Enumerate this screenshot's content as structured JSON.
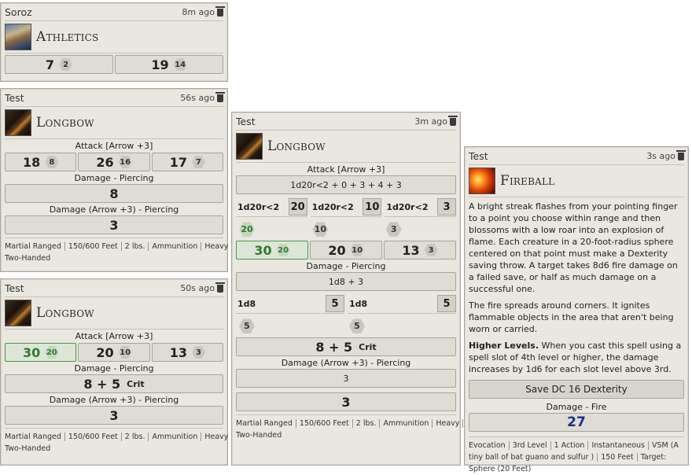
{
  "cards": {
    "athletics": {
      "user": "Soroz",
      "time": "8m ago",
      "title": "Athletics",
      "rolls": [
        {
          "total": "7",
          "die": "2"
        },
        {
          "total": "19",
          "die": "14"
        }
      ]
    },
    "longbow1": {
      "user": "Test",
      "time": "56s ago",
      "title": "Longbow",
      "attack_label": "Attack [Arrow +3]",
      "attacks": [
        {
          "total": "18",
          "die": "8"
        },
        {
          "total": "26",
          "die": "16"
        },
        {
          "total": "17",
          "die": "7"
        }
      ],
      "damage1_label": "Damage - Piercing",
      "damage1": "8",
      "damage2_label": "Damage (Arrow +3) - Piercing",
      "damage2": "3",
      "props": [
        "Martial Ranged",
        "150/600 Feet",
        "2 lbs.",
        "Ammunition",
        "Heavy",
        "Two-Handed"
      ]
    },
    "longbow2": {
      "user": "Test",
      "time": "50s ago",
      "title": "Longbow",
      "attack_label": "Attack [Arrow +3]",
      "attacks": [
        {
          "total": "30",
          "die": "20"
        },
        {
          "total": "20",
          "die": "10"
        },
        {
          "total": "13",
          "die": "3"
        }
      ],
      "damage1_label": "Damage - Piercing",
      "damage1": "8 + 5",
      "crit": "Crit",
      "damage2_label": "Damage (Arrow +3) - Piercing",
      "damage2": "3",
      "props": [
        "Martial Ranged",
        "150/600 Feet",
        "2 lbs.",
        "Ammunition",
        "Heavy",
        "Two-Handed"
      ]
    },
    "longbow3": {
      "user": "Test",
      "time": "3m ago",
      "title": "Longbow",
      "attack_label": "Attack [Arrow +3]",
      "formula": "1d20r<2 + 0 + 3 + 4 + 3",
      "dice": [
        {
          "label": "1d20r<2",
          "value": "20"
        },
        {
          "label": "1d20r<2",
          "value": "10"
        },
        {
          "label": "1d20r<2",
          "value": "3"
        }
      ],
      "attacks": [
        {
          "total": "30",
          "die": "20"
        },
        {
          "total": "20",
          "die": "10"
        },
        {
          "total": "13",
          "die": "3"
        }
      ],
      "damage1_label": "Damage - Piercing",
      "damage_formula": "1d8 + 3",
      "damage_dice": [
        {
          "label": "1d8",
          "value": "5"
        },
        {
          "label": "1d8",
          "value": "5"
        }
      ],
      "damage1": "8 + 5",
      "crit": "Crit",
      "damage2_label": "Damage (Arrow +3) - Piercing",
      "damage2_formula": "3",
      "damage2": "3",
      "props": [
        "Martial Ranged",
        "150/600 Feet",
        "2 lbs.",
        "Ammunition",
        "Heavy",
        "Two-Handed"
      ]
    },
    "fireball": {
      "user": "Test",
      "time": "3s ago",
      "title": "Fireball",
      "desc1": "A bright streak flashes from your pointing finger to a point you choose within range and then blossoms with a low roar into an explosion of flame. Each creature in a 20-foot-radius sphere centered on that point must make a Dexterity saving throw. A target takes 8d6 fire damage on a failed save, or half as much damage on a successful one.",
      "desc2": "The fire spreads around corners. It ignites flammable objects in the area that aren't being worn or carried.",
      "higher_label": "Higher Levels.",
      "higher_text": "When you cast this spell using a spell slot of 4th level or higher, the damage increases by 1d6 for each slot level above 3rd.",
      "save_button": "Save DC 16 Dexterity",
      "damage_label": "Damage - Fire",
      "damage": "27",
      "props": [
        "Evocation",
        "3rd Level",
        "1 Action",
        "Instantaneous",
        "VSM (A tiny ball of bat guano and sulfur )",
        "150 Feet",
        "Target: Sphere (20 Feet)"
      ]
    }
  }
}
